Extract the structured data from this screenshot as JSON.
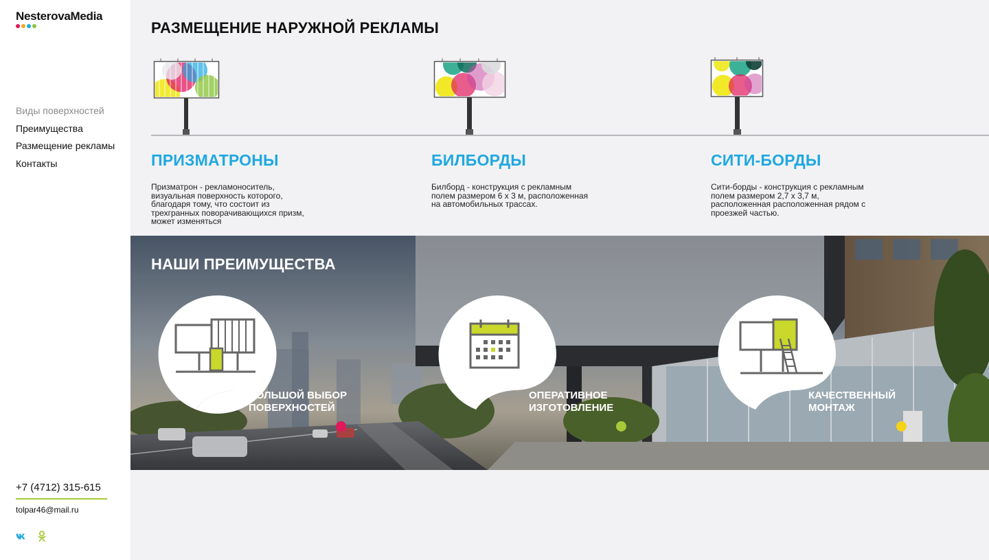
{
  "logo": {
    "text": "NesterovaMedia",
    "dot_colors": [
      "#e0185c",
      "#f3a91b",
      "#1fa8e0",
      "#8cc63f"
    ]
  },
  "nav": {
    "items": [
      {
        "label": "Виды поверхностей",
        "active": true
      },
      {
        "label": "Преимущества",
        "active": false
      },
      {
        "label": "Размещение рекламы",
        "active": false
      },
      {
        "label": "Контакты",
        "active": false
      }
    ]
  },
  "contacts": {
    "phone": "+7 (4712) 315-615",
    "email": "tolpar46@mail.ru"
  },
  "socials": [
    "vk-icon",
    "odnoklassniki-icon"
  ],
  "section_types": {
    "title": "РАЗМЕЩЕНИЕ НАРУЖНОЙ РЕКЛАМЫ",
    "items": [
      {
        "title": "ПРИЗМАТРОНЫ",
        "description_lines": [
          "Призматрон - рекламоноситель,",
          "визуальная поверхность которого,",
          "благодаря тому, что состоит из",
          "трехгранных поворачивающихся призм,",
          "может изменяться"
        ]
      },
      {
        "title": "БИЛБОРДЫ",
        "description_lines": [
          "Билборд - конструкция с рекламным",
          "полем размером 6 х 3 м, расположенная",
          "на автомобильных трассах."
        ]
      },
      {
        "title": "СИТИ-БОРДЫ",
        "description_lines": [
          "Сити-борды - конструкция с рекламным",
          "полем размером 2,7 х 3,7 м,",
          "расположенная расположенная рядом с",
          "проезжей частью."
        ]
      }
    ]
  },
  "section_advantages": {
    "title": "НАШИ ПРЕИМУЩЕСТВА",
    "items": [
      {
        "line1": "БОЛЬШОЙ ВЫБОР",
        "line2": "ПОВЕРХНОСТЕЙ",
        "dot_color": "#e0185c",
        "icon": "billboards-icon"
      },
      {
        "line1": "ОПЕРАТИВНОЕ",
        "line2": "ИЗГОТОВЛЕНИЕ",
        "dot_color": "#a7c93a",
        "icon": "calendar-icon"
      },
      {
        "line1": "КАЧЕСТВЕННЫЙ",
        "line2": "МОНТАЖ",
        "dot_color": "#f5d31a",
        "icon": "installation-icon"
      }
    ]
  },
  "colors": {
    "accent_blue": "#1fa8e0",
    "accent_green": "#a7c93a",
    "icon_yellow_green": "#c9d82b"
  }
}
